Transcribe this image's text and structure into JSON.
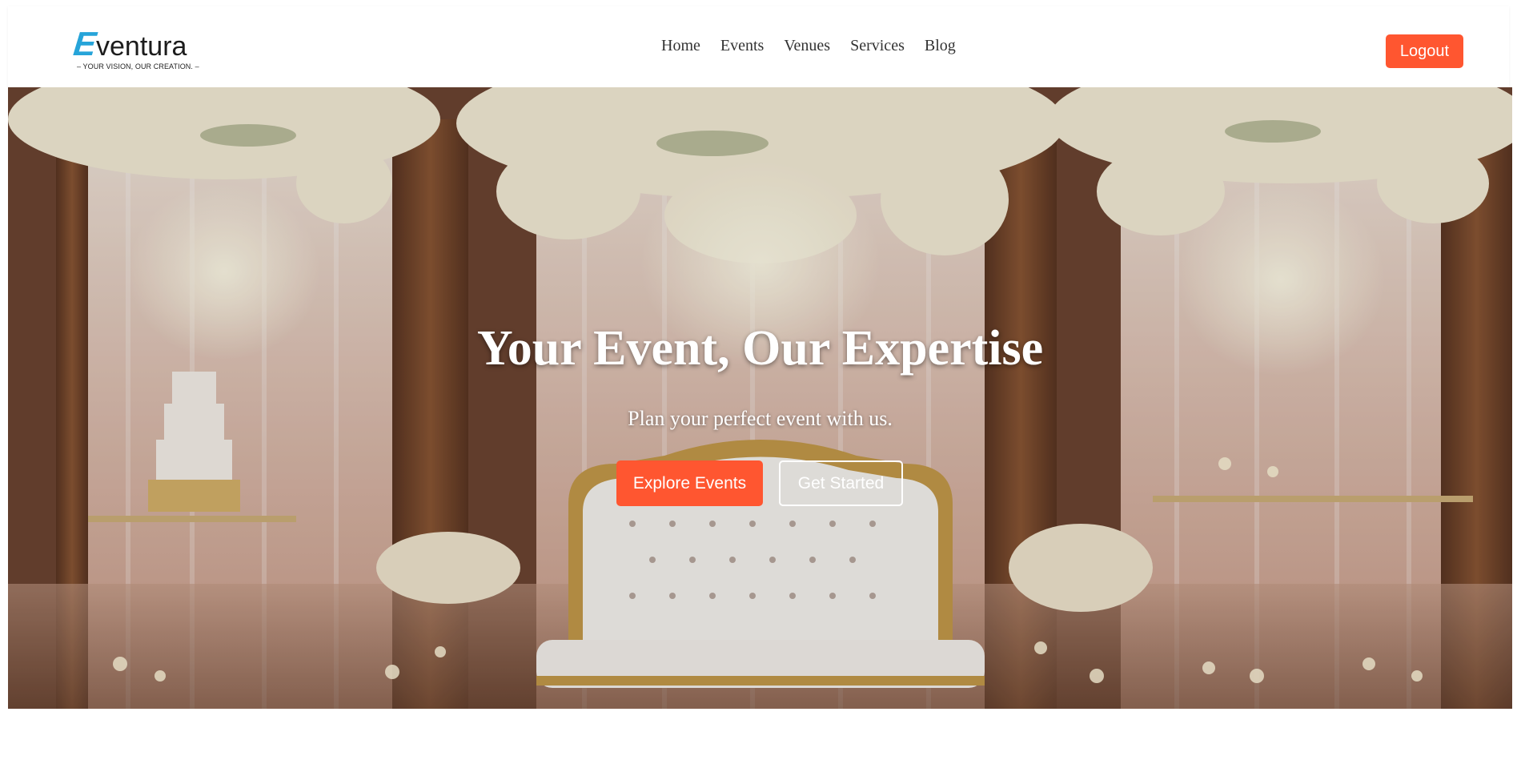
{
  "brand": {
    "name": "ventura",
    "initial": "E",
    "tagline": "– YOUR VISION, OUR CREATION. –"
  },
  "nav": {
    "links": [
      "Home",
      "Events",
      "Venues",
      "Services",
      "Blog"
    ],
    "logout_label": "Logout"
  },
  "hero": {
    "title": "Your Event, Our Expertise",
    "subtitle": "Plan your perfect event with us.",
    "primary_button": "Explore Events",
    "secondary_button": "Get Started"
  },
  "colors": {
    "accent": "#ff5630",
    "brand_blue": "#26a4d9",
    "nav_text": "#333333"
  }
}
